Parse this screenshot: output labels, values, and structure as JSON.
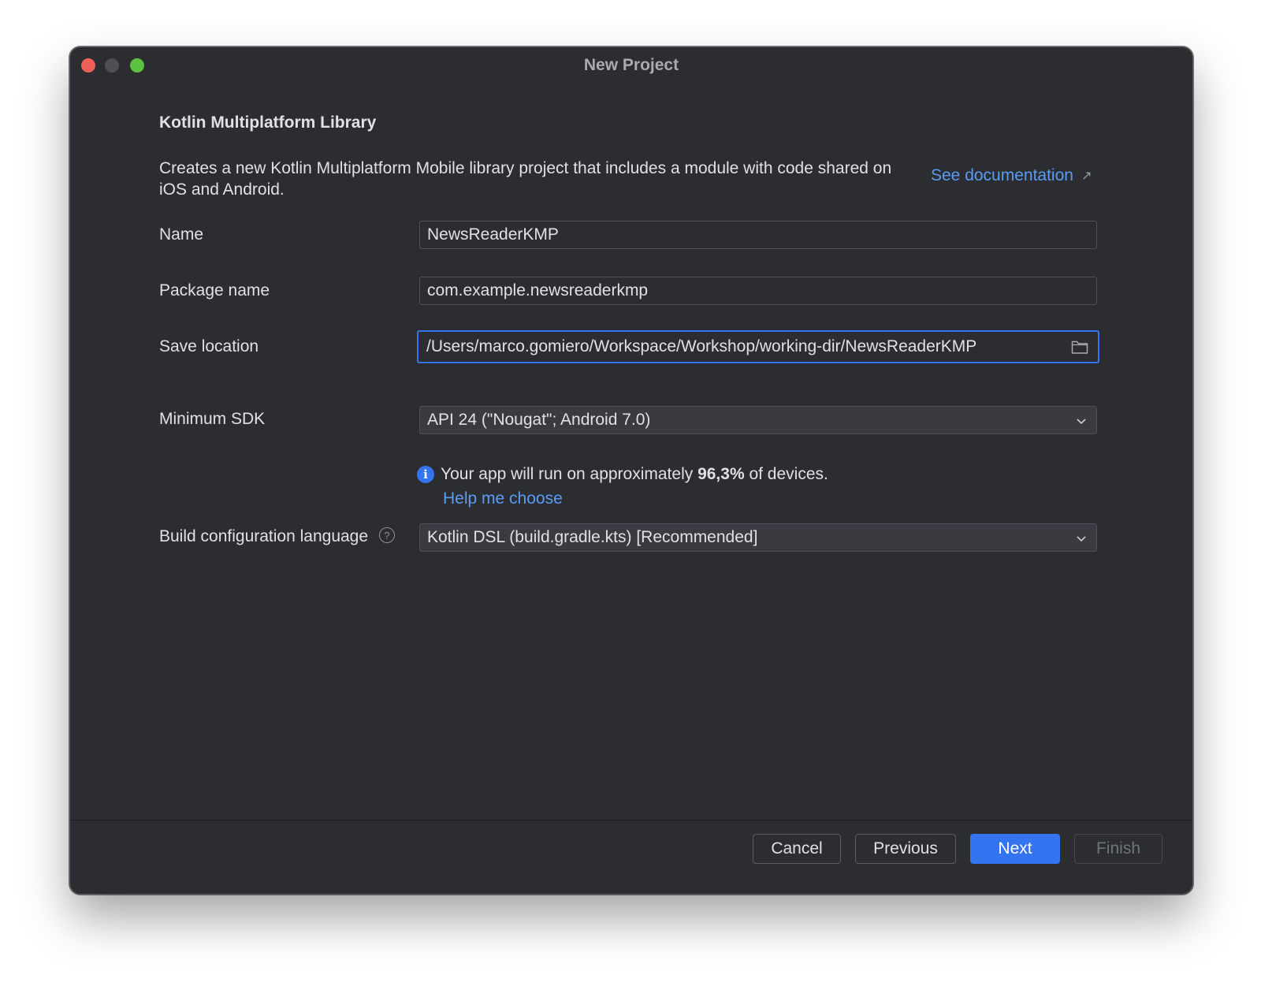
{
  "window": {
    "title": "New Project"
  },
  "header": {
    "title": "Kotlin Multiplatform Library",
    "description": "Creates a new Kotlin Multiplatform Mobile library project that includes a module with code shared on iOS and Android.",
    "doc_link": "See documentation"
  },
  "form": {
    "name": {
      "label": "Name",
      "value": "NewsReaderKMP"
    },
    "package": {
      "label": "Package name",
      "value": "com.example.newsreaderkmp"
    },
    "location": {
      "label": "Save location",
      "value": "/Users/marco.gomiero/Workspace/Workshop/working-dir/NewsReaderKMP"
    },
    "min_sdk": {
      "label": "Minimum SDK",
      "value": "API 24 (\"Nougat\"; Android 7.0)"
    },
    "info": {
      "prefix": "Your app will run on approximately ",
      "percent": "96,3%",
      "suffix": " of devices.",
      "help_link": "Help me choose"
    },
    "build_lang": {
      "label": "Build configuration language",
      "value": "Kotlin DSL (build.gradle.kts) [Recommended]"
    }
  },
  "footer": {
    "cancel": "Cancel",
    "previous": "Previous",
    "next": "Next",
    "finish": "Finish"
  },
  "colors": {
    "background": "#2b2d30",
    "accent": "#3574f0",
    "link": "#5b9bf5",
    "text": "#dfe1e5"
  }
}
